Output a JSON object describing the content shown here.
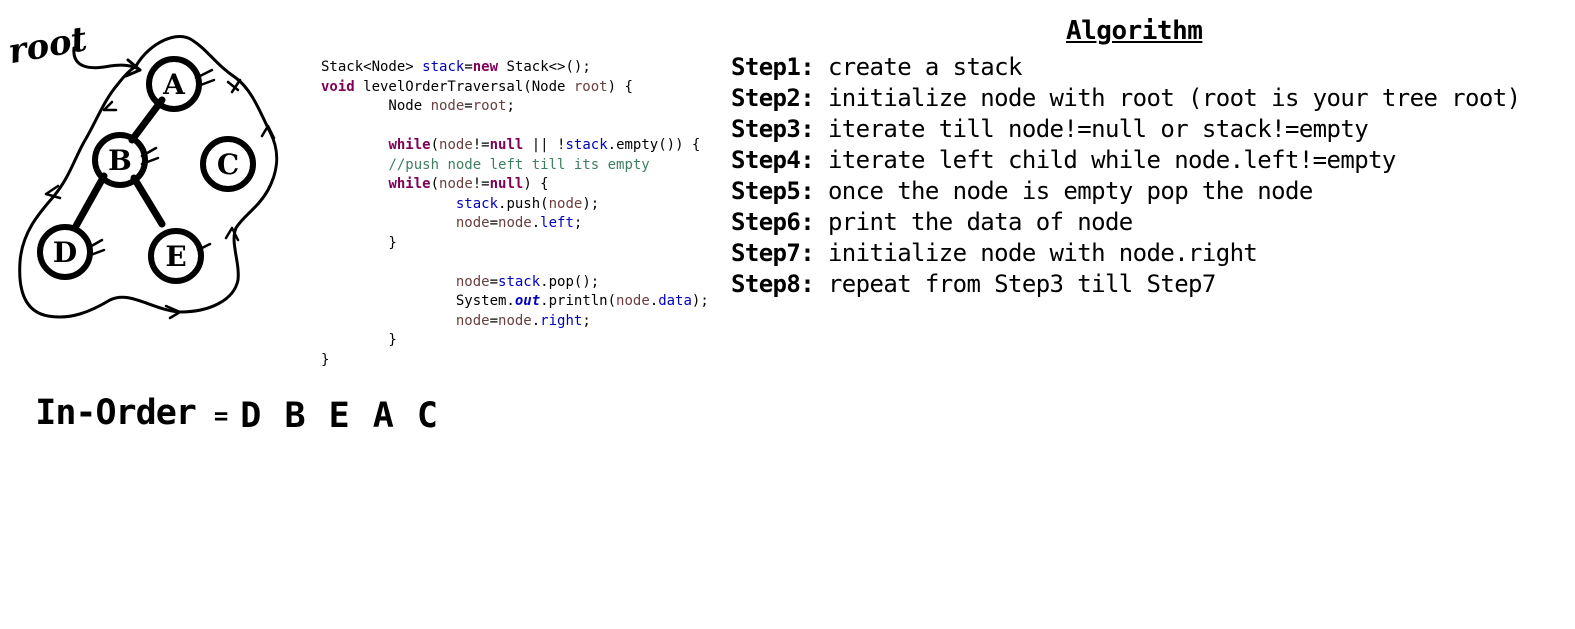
{
  "diagram": {
    "root_label": "root",
    "nodes": {
      "a": "A",
      "b": "B",
      "c": "C",
      "d": "D",
      "e": "E"
    }
  },
  "code": {
    "l01": {
      "a": "Stack<Node> ",
      "b": "stack",
      "c": "=",
      "d": "new",
      "e": " Stack<>();"
    },
    "l02": {
      "a": "void",
      "b": " levelOrderTraversal(Node ",
      "c": "root",
      "d": ") {"
    },
    "l03": {
      "a": "        Node ",
      "b": "node",
      "c": "=",
      "d": "root",
      "e": ";"
    },
    "l05": {
      "a": "        ",
      "b": "while",
      "c": "(",
      "d": "node",
      "e": "!=",
      "f": "null",
      "g": " || !",
      "h": "stack",
      "i": ".empty()) {"
    },
    "l06": {
      "a": "        ",
      "b": "//push node left till its empty"
    },
    "l07": {
      "a": "        ",
      "b": "while",
      "c": "(",
      "d": "node",
      "e": "!=",
      "f": "null",
      "g": ") {"
    },
    "l08": {
      "a": "                ",
      "b": "stack",
      "c": ".push(",
      "d": "node",
      "e": ");"
    },
    "l09": {
      "a": "                ",
      "b": "node",
      "c": "=",
      "d": "node",
      "e": ".",
      "f": "left",
      "g": ";"
    },
    "l10": {
      "a": "        }"
    },
    "l12": {
      "a": "                ",
      "b": "node",
      "c": "=",
      "d": "stack",
      "e": ".pop();"
    },
    "l13": {
      "a": "                System.",
      "b": "out",
      "c": ".println(",
      "d": "node",
      "e": ".",
      "f": "data",
      "g": ");"
    },
    "l14": {
      "a": "                ",
      "b": "node",
      "c": "=",
      "d": "node",
      "e": ".",
      "f": "right",
      "g": ";"
    },
    "l15": {
      "a": "        }"
    },
    "l16": {
      "a": "}"
    }
  },
  "algorithm": {
    "title": "Algorithm",
    "steps": [
      {
        "label": "Step1:",
        "text": " create a stack"
      },
      {
        "label": "Step2:",
        "text": " initialize node with root (root is your tree root)"
      },
      {
        "label": "Step3:",
        "text": " iterate till node!=null or stack!=empty"
      },
      {
        "label": "Step4:",
        "text": " iterate left child while node.left!=empty"
      },
      {
        "label": "Step5:",
        "text": " once the node is empty pop the node"
      },
      {
        "label": "Step6:",
        "text": " print the data of node"
      },
      {
        "label": "Step7:",
        "text": " initialize node with node.right"
      },
      {
        "label": "Step8:",
        "text": " repeat from Step3 till Step7"
      }
    ]
  },
  "inorder": {
    "label": "In-Order",
    "equals": "=",
    "sequence": "D B E A C"
  },
  "colors": {
    "keyword": "#7f0055",
    "field": "#0000c0",
    "local_variable": "#6a3e3e",
    "comment": "#3f7f5f"
  }
}
